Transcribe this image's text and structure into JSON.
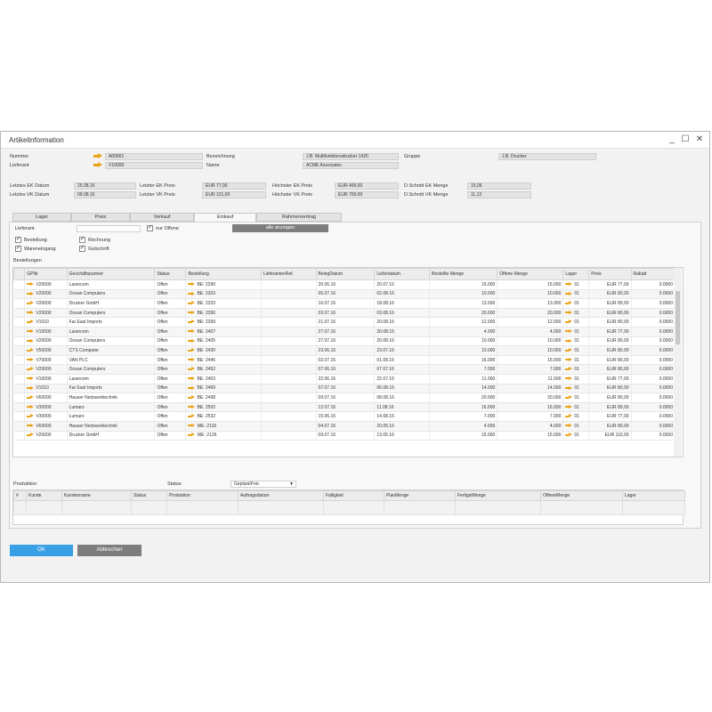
{
  "window": {
    "title": "Artikelinformation",
    "minimize": "_",
    "maximize": "☐",
    "close": "✕"
  },
  "header": {
    "nummer_label": "Nummer",
    "nummer_value": "A00001",
    "lieferant_label": "Lieferant",
    "lieferant_value": "V10000",
    "bezeichnung_label": "Bezeichnung",
    "bezeichnung_value": "J.B. Multifunktionsdrucker 1420",
    "name_label": "Name",
    "name_value": "ACME Associates",
    "gruppe_label": "Gruppe",
    "gruppe_value": "J.B. Drucker"
  },
  "prices": {
    "letztes_ek_datum_label": "Letztes EK Datum",
    "letztes_ek_datum_value": "25.08.16",
    "letztes_vk_datum_label": "Letztes VK Datum",
    "letztes_vk_datum_value": "09.08.16",
    "letzter_ek_preis_label": "Letzter EK Preis",
    "letzter_ek_preis_value": "EUR 77,00",
    "letzter_vk_preis_label": "Letzter VK Preis",
    "letzter_vk_preis_value": "EUR 121,00",
    "hoechster_ek_preis_label": "Höchster EK Preis",
    "hoechster_ek_preis_value": "EUR 400,00",
    "hoechster_vk_preis_label": "Höchster VK Preis",
    "hoechster_vk_preis_value": "EUR 700,00",
    "dschnitt_ek_menge_label": "D.Schnitt EK Menge",
    "dschnitt_ek_menge_value": "15,06",
    "dschnitt_vk_menge_label": "D.Schnitt VK Menge",
    "dschnitt_vk_menge_value": "11,13"
  },
  "tabs": [
    "Lager",
    "Preis",
    "Verkauf",
    "Einkauf",
    "Rahmenvertrag"
  ],
  "filters": {
    "lieferant_label": "Lieferant",
    "nur_offene_label": "nur Offene",
    "alle_anzeigen_label": "alle anzeigen",
    "bestellung_label": "Bestellung",
    "wareneingang_label": "Wareneingang",
    "rechnung_label": "Rechnung",
    "gutschrift_label": "Gutschrift"
  },
  "bestellungen": {
    "section_label": "Bestellungen",
    "columns": [
      "GPNr",
      "Geschäftspartner",
      "Status",
      "Bestellung",
      "LieferantenRef.",
      "BelegDatum",
      "Lieferdatum",
      "Bestellte Menge",
      "Offene Menge",
      "Lager",
      "Preis",
      "Rabatt"
    ],
    "rows": [
      [
        "V20000",
        "Lasercom",
        "Offen",
        "BE: 2290",
        "",
        "20.06.16",
        "20.07.16",
        "15.000",
        "15.000",
        "01",
        "EUR 77,00",
        "0.0000"
      ],
      [
        "V20000",
        "Ocean Computers",
        "Offen",
        "BE: 2303",
        "",
        "05.07.16",
        "02.08.16",
        "10.000",
        "10.000",
        "01",
        "EUR 80,00",
        "0.0000"
      ],
      [
        "V20000",
        "Drucker GmbH",
        "Offen",
        "BE: 2333",
        "",
        "16.07.16",
        "18.08.16",
        "13.000",
        "13.000",
        "01",
        "EUR 80,00",
        "0.0000"
      ],
      [
        "V20000",
        "Ocean Computers",
        "Offen",
        "BE: 2356",
        "",
        "03.07.16",
        "03.08.16",
        "20.000",
        "20.000",
        "01",
        "EUR 80,00",
        "0.0000"
      ],
      [
        "V1010",
        "Far East Imports",
        "Offen",
        "BE: 2399",
        "",
        "21.07.16",
        "20.08.16",
        "12.000",
        "12.000",
        "01",
        "EUR 80,00",
        "0.0000"
      ],
      [
        "V10000",
        "Lasercom",
        "Offen",
        "BE: 2407",
        "",
        "27.07.16",
        "20.08.16",
        "4.000",
        "4.000",
        "01",
        "EUR 77,00",
        "0.0000"
      ],
      [
        "V20000",
        "Ocean Computers",
        "Offen",
        "BE: 2405",
        "",
        "27.07.16",
        "20.08.16",
        "10.000",
        "10.000",
        "01",
        "EUR 80,00",
        "0.0000"
      ],
      [
        "V50000",
        "CTS Computer",
        "Offen",
        "BE: 2430",
        "",
        "23.06.16",
        "23.07.16",
        "10.000",
        "10.000",
        "01",
        "EUR 80,00",
        "0.0000"
      ],
      [
        "V70000",
        "VAN PLC",
        "Offen",
        "BE: 2446",
        "",
        "02.07.16",
        "01.08.16",
        "16.000",
        "16.000",
        "01",
        "EUR 80,00",
        "0.0000"
      ],
      [
        "V20000",
        "Ocean Computers",
        "Offen",
        "BE: 2452",
        "",
        "07.06.16",
        "07.07.16",
        "7.000",
        "7.000",
        "01",
        "EUR 80,00",
        "0.0000"
      ],
      [
        "V10000",
        "Lasercom",
        "Offen",
        "BE: 2453",
        "",
        "22.06.16",
        "22.07.16",
        "11.000",
        "11.000",
        "01",
        "EUR 77,00",
        "0.0000"
      ],
      [
        "V1010",
        "Far East Imports",
        "Offen",
        "BE: 2469",
        "",
        "07.07.16",
        "06.08.16",
        "14.000",
        "14.000",
        "01",
        "EUR 80,00",
        "0.0000"
      ],
      [
        "V60000",
        "Hauser Netzwerktechnik",
        "Offen",
        "BE: 2498",
        "",
        "09.07.16",
        "08.08.16",
        "20.000",
        "20.000",
        "01",
        "EUR 80,00",
        "0.0000"
      ],
      [
        "V30000",
        "Lumaro",
        "Offen",
        "BE: 2502",
        "",
        "12.07.16",
        "11.08.16",
        "16.000",
        "16.000",
        "01",
        "EUR 80,00",
        "0.0000"
      ],
      [
        "V30000",
        "Lumaro",
        "Offen",
        "BE: 2532",
        "",
        "15.06.16",
        "14.08.16",
        "7.000",
        "7.000",
        "01",
        "EUR 77,00",
        "0.0000"
      ],
      [
        "V60000",
        "Hauser Netzwerktechnik",
        "Offen",
        "WE: 2118",
        "",
        "04.07.16",
        "20.05.16",
        "4.000",
        "4.000",
        "01",
        "EUR 80,00",
        "0.0000"
      ],
      [
        "V20000",
        "Drucker GmbH",
        "Offen",
        "WE: 2126",
        "",
        "09.07.16",
        "13.05.16",
        "15.000",
        "15.000",
        "01",
        "EUR 110,00",
        "0.0000"
      ]
    ]
  },
  "produktion": {
    "section_label": "Produktion",
    "status_label": "Status",
    "status_value": "Geplant/Frei.",
    "columns": [
      "#",
      "Kunde",
      "Kundenname",
      "Status",
      "Produktion",
      "Auftragsdatum",
      "Fälligkeit",
      "PlanMenge",
      "FertigstMenge",
      "OffeneMenge",
      "Lager"
    ]
  },
  "buttons": {
    "ok": "OK",
    "cancel": "Abbrechen"
  },
  "colors": {
    "arrow": "#e8a317",
    "ok": "#3aa0e6",
    "grey_button": "#7d7d7d"
  }
}
